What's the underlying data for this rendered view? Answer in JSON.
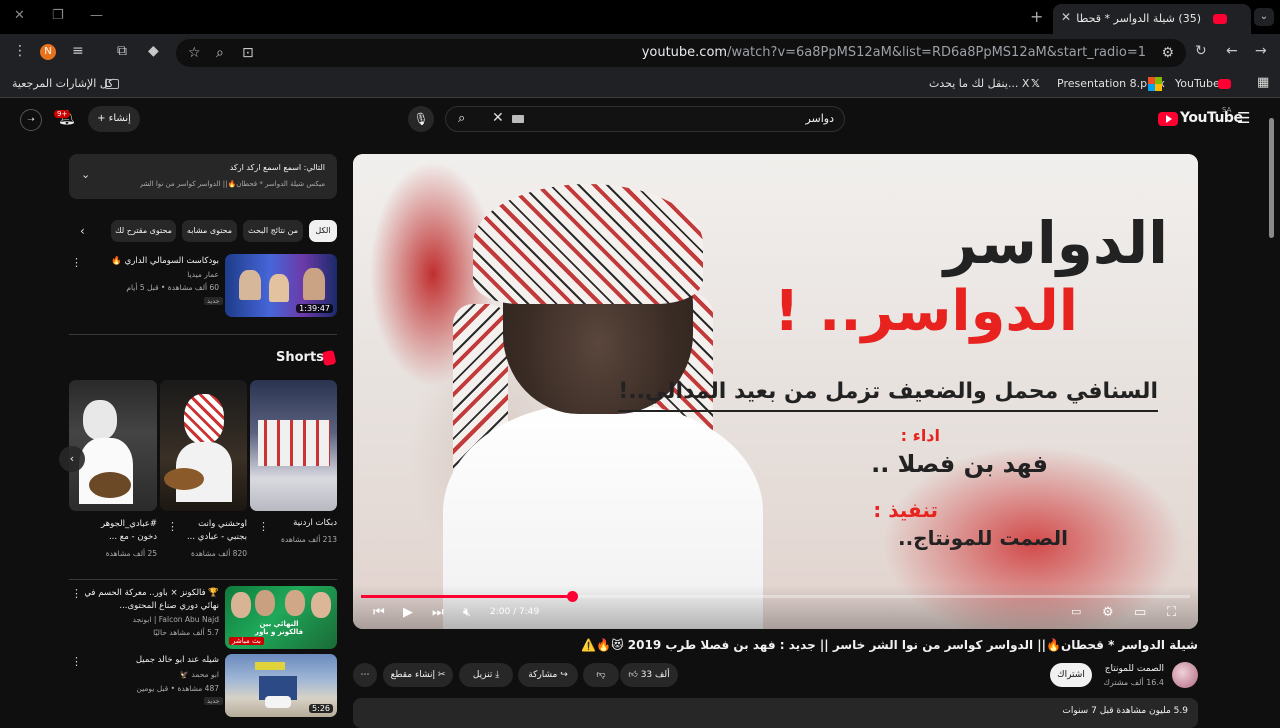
{
  "browser": {
    "tab_title": "(35) شيلة الدواسر * قحطان🔥|| الـ",
    "url_host": "youtube.com",
    "url_path": "/watch?v=6a8PpMS12aM&list=RD6a8PpMS12aM&start_radio=1",
    "profile_initial": "N",
    "bookmarks": {
      "all_label": "كل الإشارات المرجعية",
      "youtube": "YouTube",
      "presentation": "Presentation 8.pptx",
      "x_label": "ينقل لك ما يحدث... X"
    }
  },
  "masthead": {
    "search_query": "دواسر",
    "create_label": "إنشاء",
    "notif_count": "9+",
    "logo_text": "YouTube",
    "country": "SA"
  },
  "player": {
    "overlay": {
      "line1": "الدواسر",
      "line2": "الدواسر.. !",
      "line3": "السنافي محمل والضعيف تزمل من بعيد المدالي..!",
      "line4": "اداء :",
      "line5": "فهد بن فصلا ..",
      "line6": "تنفيذ :",
      "line7": "الصمت للمونتاج.."
    },
    "time": "2:00 / 7:49",
    "progress": 0.255
  },
  "video": {
    "title": "شيلة الدواسر * قحطان🔥|| الدواسر كواسر من نوا الشر خاسر || جديد : فهد بن فصلا طرب 2019 😻🔥⚠️",
    "channel": "الصمت للمونتاج",
    "subs": "16.4 ألف مشترك",
    "subscribe": "اشتراك",
    "likes": "33 ألف",
    "share": "مشاركة",
    "download": "تنزيل",
    "clip": "إنشاء مقطع",
    "views_date": "5.9 مليون مشاهدة  قبل 7 سنوات"
  },
  "sidebar": {
    "upnext_title": "التالي: اسمع اسمع اركد اركد",
    "upnext_sub": "ميكس شيلة الدواسر * قحطان🔥|| الدواسر كواسر من نوا الشر خاسر || جديد : فهد بن...",
    "chips": [
      "الكل",
      "من نتائج البحث",
      "محتوى مشابه",
      "محتوى مقترح لك"
    ],
    "video1": {
      "title": "بودكاست السومالي الداري 🔥",
      "channel": "عمار ميديا",
      "meta": "60 ألف مشاهدة • قبل 5 أيام",
      "badge": "جديد",
      "duration": "1:39:47"
    },
    "shorts_title": "Shorts",
    "shorts": [
      {
        "title": "دبكات اردنية",
        "views": "213 ألف مشاهدة"
      },
      {
        "title": "اوحشني وانت بجنبي - عبادي ...",
        "views": "820 ألف مشاهدة"
      },
      {
        "title": "#عبادي_الجوهر دخون - مع ...",
        "views": "25 ألف مشاهدة"
      }
    ],
    "video2": {
      "title": "🏆 فالكونز × باور.. معركة الحسم في نهائي دوري صناع المحتوى...",
      "channel": "Falcon Abu Najd | ابونجد",
      "meta": "5.7 ألف مشاهد حاليًا",
      "live": "بث مباشر",
      "thumb_text": "النهائي بين فالكونز و باور"
    },
    "video3": {
      "title": "شيله عند ابو خالد جميل",
      "channel": "ابو محمد 🦅",
      "meta": "487 مشاهدة • قبل يومين",
      "badge": "جديد",
      "duration": "5:26"
    }
  }
}
